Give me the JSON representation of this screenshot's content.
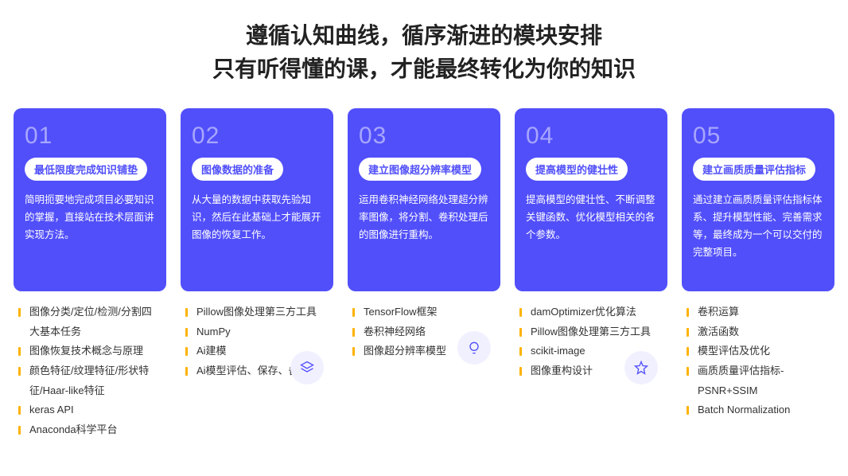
{
  "header": {
    "line1": "遵循认知曲线，循序渐进的模块安排",
    "line2": "只有听得懂的课，才能最终转化为你的知识"
  },
  "cards": [
    {
      "num": "01",
      "title": "最低限度完成知识铺垫",
      "desc": "简明扼要地完成项目必要知识的掌握，直接站在技术层面讲实现方法。",
      "items": [
        "图像分类/定位/检测/分割四大基本任务",
        "图像恢复技术概念与原理",
        "颜色特征/纹理特征/形状特征/Haar-like特征",
        "keras API",
        "Anaconda科学平台"
      ],
      "icon": null
    },
    {
      "num": "02",
      "title": "图像数据的准备",
      "desc": "从大量的数据中获取先验知识，然后在此基础上才能展开图像的恢复工作。",
      "items": [
        "Pillow图像处理第三方工具",
        "NumPy",
        "Ai建模",
        "Ai模型评估、保存、备份"
      ],
      "icon": "layers-icon"
    },
    {
      "num": "03",
      "title": "建立图像超分辨率模型",
      "desc": "运用卷积神经网络处理超分辨率图像，将分割、卷积处理后的图像进行重构。",
      "items": [
        "TensorFlow框架",
        "卷积神经网络",
        "图像超分辨率模型"
      ],
      "icon": "bulb-icon"
    },
    {
      "num": "04",
      "title": "提高模型的健壮性",
      "desc": "提高模型的健壮性、不断调整关键函数、优化模型相关的各个参数。",
      "items": [
        "damOptimizer优化算法",
        "Pillow图像处理第三方工具",
        "scikit-image",
        "图像重构设计"
      ],
      "icon": "star-icon"
    },
    {
      "num": "05",
      "title": "建立画质质量评估指标",
      "desc": "通过建立画质质量评估指标体系、提升模型性能、完善需求等，最终成为一个可以交付的完整项目。",
      "items": [
        "卷积运算",
        "激活函数",
        "模型评估及优化",
        "画质质量评估指标-PSNR+SSIM",
        "Batch Normalization"
      ],
      "icon": null
    }
  ]
}
